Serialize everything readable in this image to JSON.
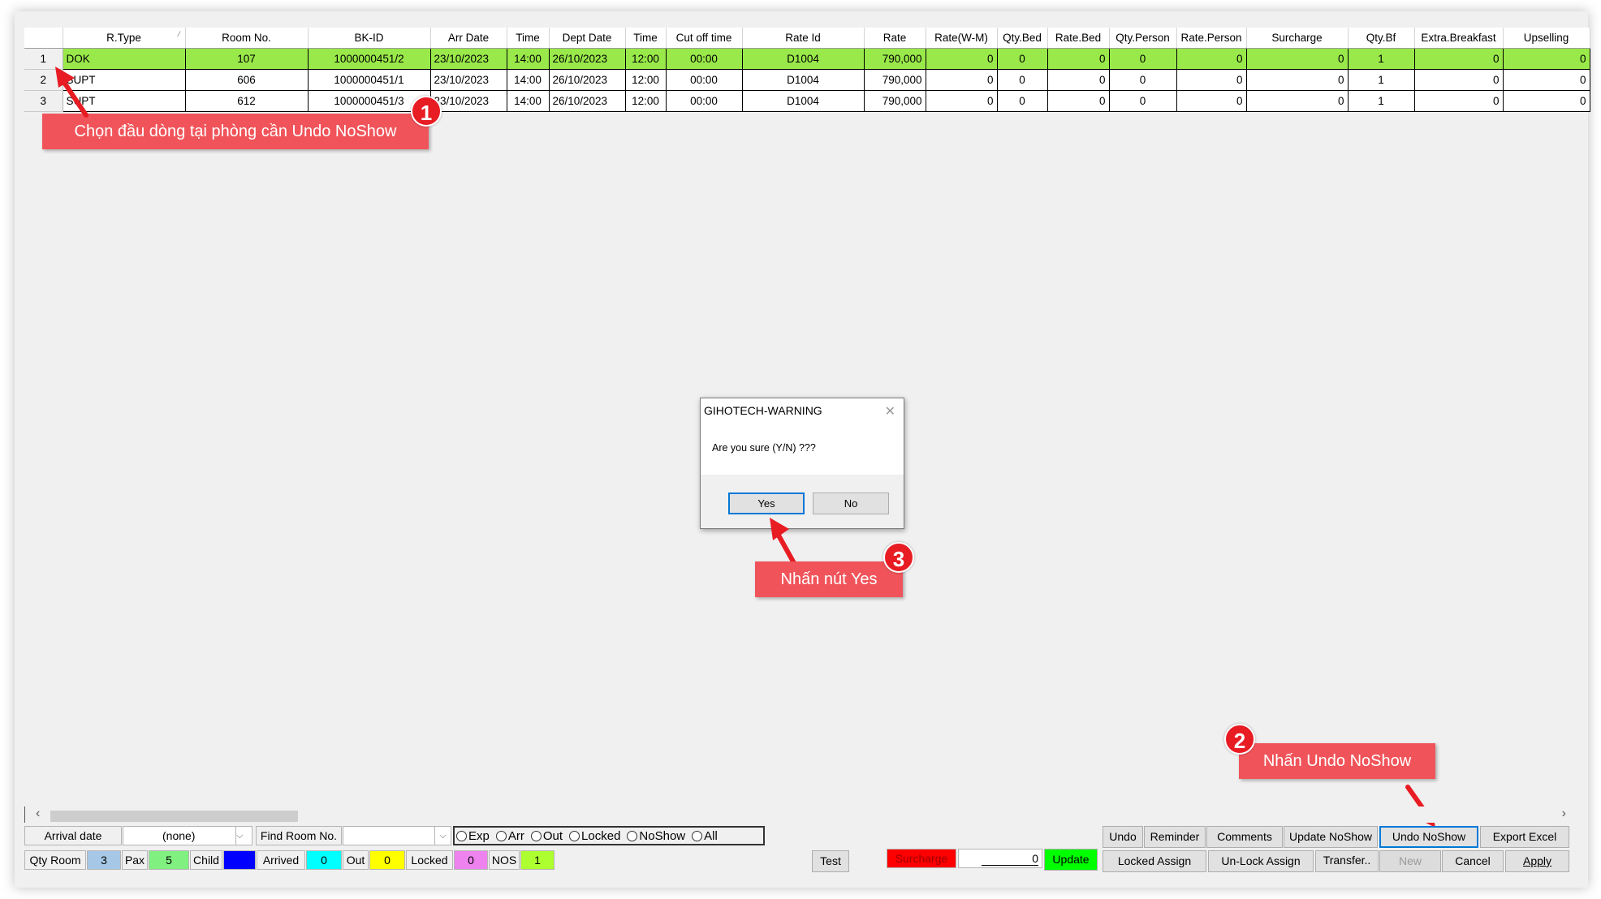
{
  "columns": [
    "R.Type",
    "Room No.",
    "BK-ID",
    "Arr Date",
    "Time",
    "Dept Date",
    "Time",
    "Cut off time",
    "Rate Id",
    "Rate",
    "Rate(W-M)",
    "Qty.Bed",
    "Rate.Bed",
    "Qty.Person",
    "Rate.Person",
    "Surcharge",
    "Qty.Bf",
    "Extra.Breakfast",
    "Upselling"
  ],
  "rows": [
    {
      "num": "1",
      "cells": [
        "DOK",
        "107",
        "1000000451/2",
        "23/10/2023",
        "14:00",
        "26/10/2023",
        "12:00",
        "00:00",
        "D1004",
        "790,000",
        "0",
        "0",
        "0",
        "0",
        "0",
        "0",
        "1",
        "0",
        "0"
      ]
    },
    {
      "num": "2",
      "cells": [
        "SUPT",
        "606",
        "1000000451/1",
        "23/10/2023",
        "14:00",
        "26/10/2023",
        "12:00",
        "00:00",
        "D1004",
        "790,000",
        "0",
        "0",
        "0",
        "0",
        "0",
        "0",
        "1",
        "0",
        "0"
      ]
    },
    {
      "num": "3",
      "cells": [
        "SUPT",
        "612",
        "1000000451/3",
        "23/10/2023",
        "14:00",
        "26/10/2023",
        "12:00",
        "00:00",
        "D1004",
        "790,000",
        "0",
        "0",
        "0",
        "0",
        "0",
        "0",
        "1",
        "0",
        "0"
      ]
    }
  ],
  "selected_row": 0,
  "dialog": {
    "title": "GIHOTECH-WARNING",
    "message": "Are you sure (Y/N) ???",
    "yes_label": "Yes",
    "no_label": "No"
  },
  "annotations": {
    "step1_text": "Chọn đầu dòng tại phòng cần Undo NoShow",
    "step1_num": "1",
    "step2_text": "Nhấn Undo NoShow",
    "step2_num": "2",
    "step3_text": "Nhấn nút Yes",
    "step3_num": "3"
  },
  "filter": {
    "arrival_date_label": "Arrival date",
    "arrival_date_value": "(none)",
    "find_room_label": "Find Room No.",
    "find_room_value": "",
    "radio_options": [
      "Exp",
      "Arr",
      "Out",
      "Locked",
      "NoShow",
      "All"
    ]
  },
  "stats": {
    "qty_room_label": "Qty Room",
    "qty_room": "3",
    "pax_label": "Pax",
    "pax": "5",
    "child_label": "Child",
    "child": "",
    "arrived_label": "Arrived",
    "arrived": "0",
    "out_label": "Out",
    "out": "0",
    "locked_label": "Locked",
    "locked": "0",
    "nos_label": "NOS",
    "nos": "1"
  },
  "actions": {
    "test": "Test",
    "surcharge": "Surcharge",
    "surcharge_value": "0",
    "update": "Update",
    "undo": "Undo",
    "reminder": "Reminder",
    "comments": "Comments",
    "update_noshow": "Update NoShow",
    "undo_noshow": "Undo NoShow",
    "export_excel": "Export Excel",
    "locked_assign": "Locked Assign",
    "unlock_assign": "Un-Lock Assign",
    "transfer": "Transfer..",
    "new": "New",
    "cancel": "Cancel",
    "apply": "Apply"
  },
  "colors": {
    "selected_row": "#99e94a",
    "callout": "#f0545a",
    "step_badge": "#e81c23",
    "arrow": "#e81c23",
    "qty_room_bg": "#a6c8e6",
    "pax_bg": "#80f080",
    "child_bg": "#0000ff",
    "arrived_bg": "#00ffff",
    "out_bg": "#ffff00",
    "locked_bg": "#ee82ee",
    "nos_bg": "#adff2f",
    "surcharge_bg": "#ff0000",
    "update_bg": "#00ff00"
  }
}
